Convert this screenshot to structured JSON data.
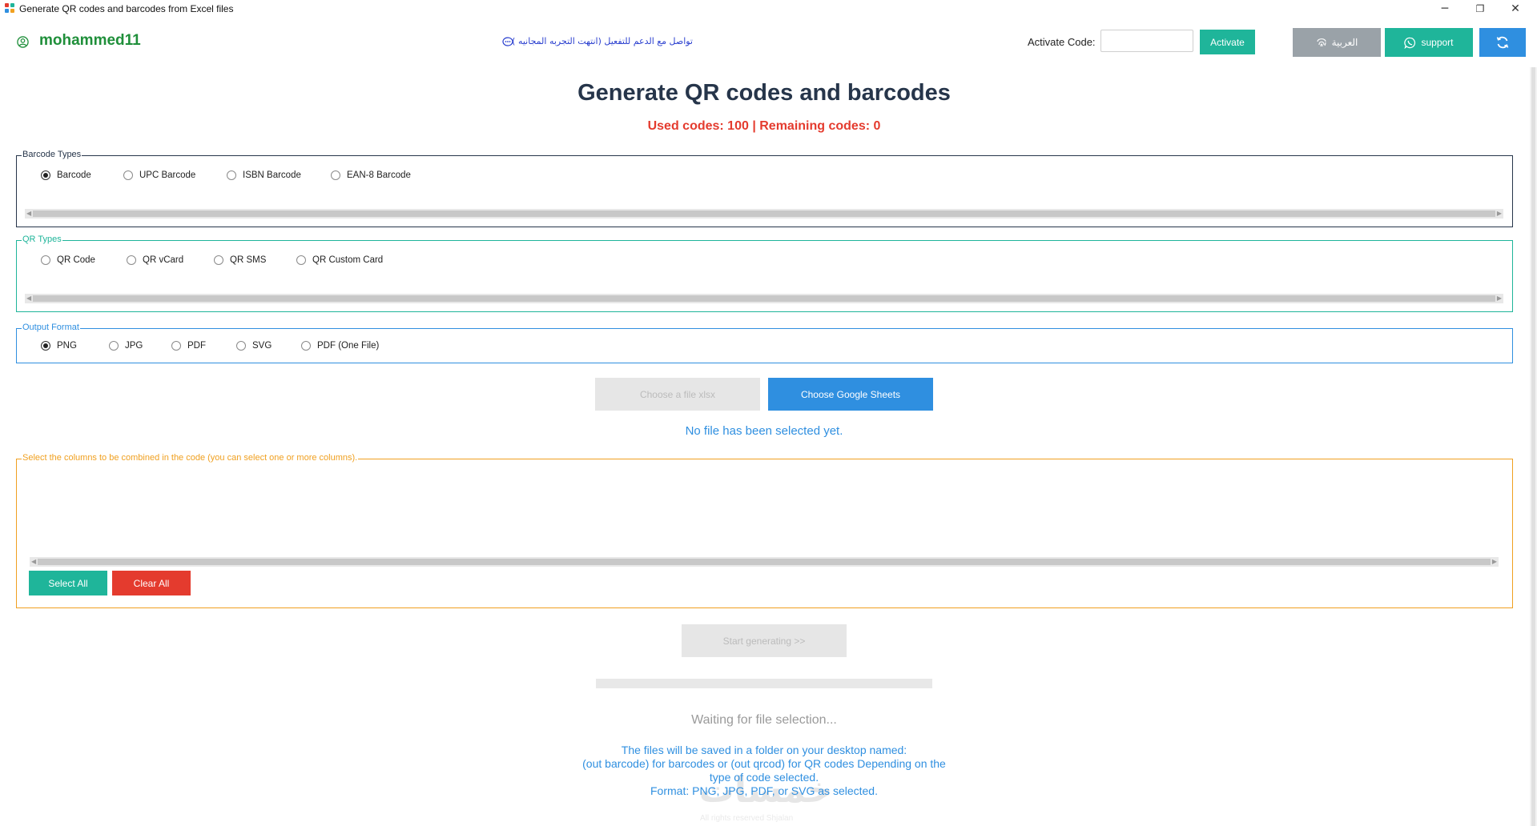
{
  "window": {
    "title": "Generate QR codes and barcodes from Excel files",
    "controls": {
      "minimize": "─",
      "restore": "❐",
      "close": "✕"
    }
  },
  "header": {
    "username": "mohammed11",
    "support_message": "تواصل مع الدعم للتفعيل (انتهت التجربه المجانيه )",
    "activate_label": "Activate Code:",
    "activate_input_value": "",
    "activate_button": "Activate",
    "language_button": "العربية",
    "support_button": "support"
  },
  "main": {
    "title": "Generate QR codes and barcodes",
    "usage": "Used codes: 100 | Remaining codes: 0"
  },
  "barcode_types": {
    "legend": "Barcode Types",
    "options": [
      "Barcode",
      "UPC Barcode",
      "ISBN Barcode",
      "EAN-8 Barcode"
    ],
    "selected": "Barcode"
  },
  "qr_types": {
    "legend": "QR Types",
    "options": [
      "QR Code",
      "QR vCard",
      "QR SMS",
      "QR Custom Card"
    ],
    "selected": ""
  },
  "output_format": {
    "legend": "Output Format",
    "options": [
      "PNG",
      "JPG",
      "PDF",
      "SVG",
      "PDF (One File)"
    ],
    "selected": "PNG"
  },
  "file_selection": {
    "xlsx_button": "Choose a file xlsx",
    "sheets_button": "Choose Google Sheets",
    "status": "No file has been selected yet."
  },
  "columns": {
    "legend": "Select the columns to be combined in the code (you can select one or more columns).",
    "select_all": "Select All",
    "clear_all": "Clear All"
  },
  "generate": {
    "start_button": "Start generating >>",
    "progress_percent": 0,
    "status": "Waiting for file selection...",
    "info_lines": [
      "The files will be saved in a folder on your desktop named:",
      "(out barcode) for barcodes or (out qrcod) for QR codes Depending on the",
      "type of code selected.",
      "Format: PNG, JPG, PDF, or SVG as selected."
    ]
  },
  "watermark": {
    "logo_text": "خمسات",
    "caption": "All rights reserved Shjalan"
  },
  "colors": {
    "teal": "#1fb59a",
    "blue": "#2f8fe0",
    "red": "#e43b2e",
    "gray": "#9aa2a8",
    "green": "#1f8f3a",
    "orange": "#f0a020"
  }
}
